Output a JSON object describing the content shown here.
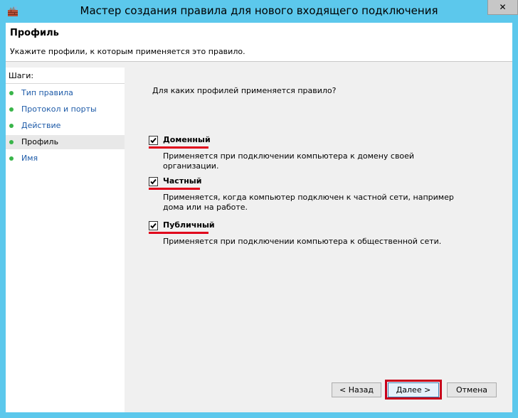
{
  "window": {
    "title": "Мастер создания правила для нового входящего подключения",
    "close_label": "✕"
  },
  "header": {
    "title": "Профиль",
    "subtitle": "Укажите профили, к которым применяется это правило."
  },
  "steps": {
    "title": "Шаги:",
    "items": [
      {
        "label": "Тип правила"
      },
      {
        "label": "Протокол и порты"
      },
      {
        "label": "Действие"
      },
      {
        "label": "Профиль"
      },
      {
        "label": "Имя"
      }
    ]
  },
  "content": {
    "question": "Для каких профилей применяется правило?",
    "profiles": [
      {
        "label": "Доменный",
        "checked": true,
        "description": "Применяется при подключении компьютера к домену своей организации."
      },
      {
        "label": "Частный",
        "checked": true,
        "description": "Применяется, когда компьютер подключен к частной сети, например дома или на работе."
      },
      {
        "label": "Публичный",
        "checked": true,
        "description": "Применяется при подключении компьютера к общественной сети."
      }
    ]
  },
  "buttons": {
    "back": "< Назад",
    "next": "Далее >",
    "cancel": "Отмена"
  },
  "colors": {
    "titlebar": "#5cc8ec",
    "step_dot": "#39b54a",
    "step_link": "#1e5ba8",
    "highlight": "#e0001a"
  }
}
